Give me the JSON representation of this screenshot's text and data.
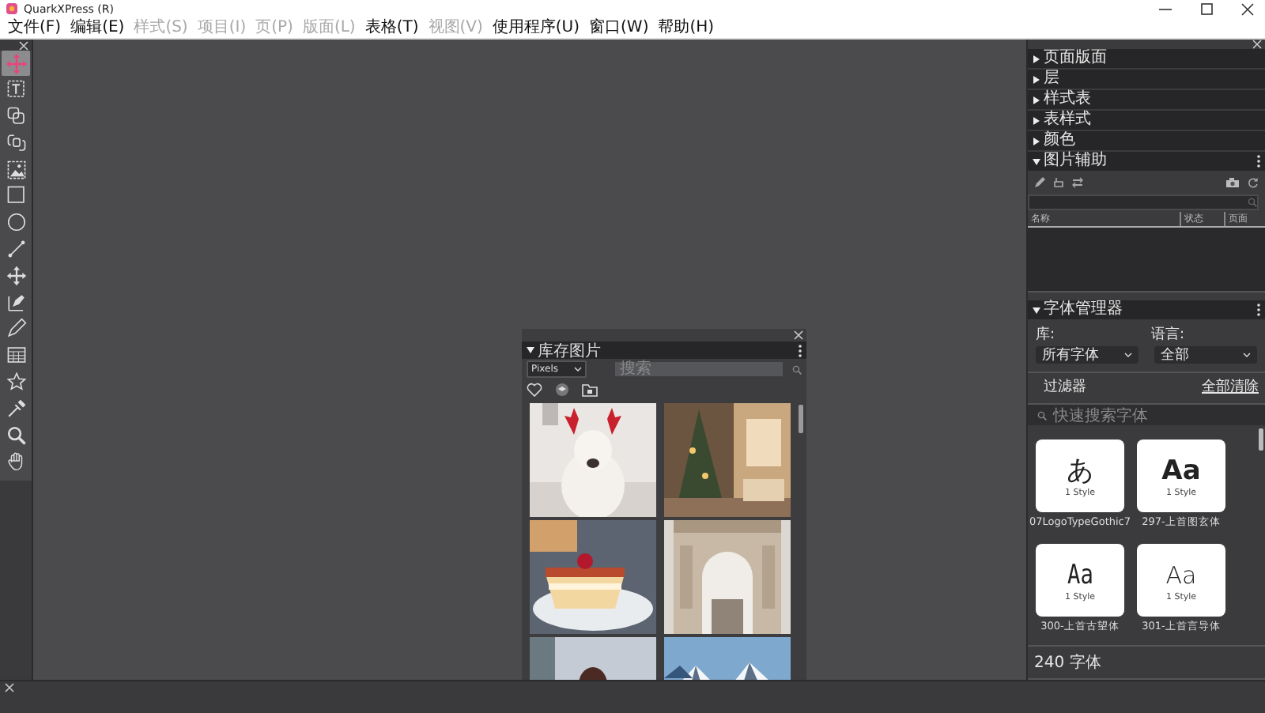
{
  "window": {
    "title": "QuarkXPress (R)"
  },
  "menu": [
    {
      "label": "文件(F)",
      "disabled": false
    },
    {
      "label": "编辑(E)",
      "disabled": false
    },
    {
      "label": "样式(S)",
      "disabled": true
    },
    {
      "label": "项目(I)",
      "disabled": true
    },
    {
      "label": "页(P)",
      "disabled": true
    },
    {
      "label": "版面(L)",
      "disabled": true
    },
    {
      "label": "表格(T)",
      "disabled": false
    },
    {
      "label": "视图(V)",
      "disabled": true
    },
    {
      "label": "使用程序(U)",
      "disabled": false
    },
    {
      "label": "窗口(W)",
      "disabled": false
    },
    {
      "label": "帮助(H)",
      "disabled": false
    }
  ],
  "tools": [
    {
      "selected": true
    },
    {
      "selected": false
    },
    {
      "selected": false
    },
    {
      "selected": false
    },
    {
      "selected": false
    },
    {
      "selected": false
    },
    {
      "selected": false
    },
    {
      "selected": false
    },
    {
      "selected": false
    },
    {
      "selected": false
    },
    {
      "selected": false
    },
    {
      "selected": false
    },
    {
      "selected": false
    },
    {
      "selected": false
    },
    {
      "selected": false
    },
    {
      "selected": false
    }
  ],
  "palettes": [
    {
      "title": "页面版面",
      "expanded": false
    },
    {
      "title": "层",
      "expanded": false
    },
    {
      "title": "样式表",
      "expanded": false
    },
    {
      "title": "表样式",
      "expanded": false
    },
    {
      "title": "颜色",
      "expanded": false
    },
    {
      "title": "图片辅助",
      "expanded": true
    }
  ],
  "image_assist": {
    "columns": [
      "名称",
      "状态",
      "页面"
    ]
  },
  "font_manager": {
    "title": "字体管理器",
    "expanded": true,
    "library_label": "库:",
    "library_value": "所有字体",
    "language_label": "语言:",
    "language_value": "全部",
    "filter": "过滤器",
    "clear_all": "全部清除",
    "search_placeholder": "快速搜索字体",
    "fonts": [
      {
        "sample": "あ",
        "styles": "1 Style",
        "name": "07LogoTypeGothic7"
      },
      {
        "sample": "Aa",
        "styles": "1 Style",
        "name": "297-上首图玄体"
      },
      {
        "sample": "Aa",
        "styles": "1 Style",
        "name": "300-上首古望体"
      },
      {
        "sample": "Aa",
        "styles": "1 Style",
        "name": "301-上首言导体"
      }
    ],
    "count": "240 字体"
  },
  "stock_images": {
    "title": "库存图片",
    "expanded": true,
    "source": "Pixels",
    "search_placeholder": "搜索"
  }
}
